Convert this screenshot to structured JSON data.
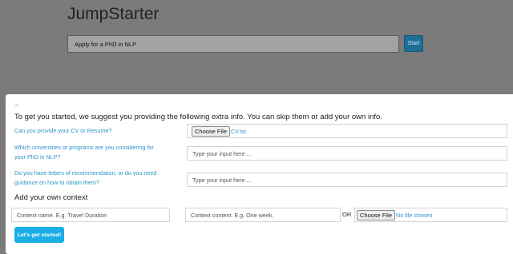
{
  "app": {
    "title": "JumpStarter",
    "goal_value": "Apply for a PhD in NLP",
    "start_label": "Start"
  },
  "modal": {
    "close_glyph": "×",
    "intro": "To get you started, we suggest you providing the following extra info. You can skip them or add your own info.",
    "questions": [
      {
        "label": "Can you provide your CV or Resume?",
        "type": "file",
        "button": "Choose File",
        "file_name": "CV.txt"
      },
      {
        "label": "Which universities or programs are you considering for your PhD in NLP?",
        "type": "text",
        "placeholder": "Type your input here ..."
      },
      {
        "label": "Do you have letters of recommendation, or do you need guidance on how to obtain them?",
        "type": "text",
        "placeholder": "Type your input here ..."
      }
    ],
    "own_context": {
      "title": "Add your own context",
      "name_placeholder": "Context name. E.g. Travel Duration",
      "content_placeholder": "Context content. E.g. One week.",
      "or_label": "OR",
      "file_button": "Choose File",
      "file_status": "No file chosen"
    },
    "submit_label": "Let's get started!"
  },
  "colors": {
    "backdrop": "#7b7b7b",
    "accent": "#2a95c9",
    "primary_button": "#19aee6"
  }
}
